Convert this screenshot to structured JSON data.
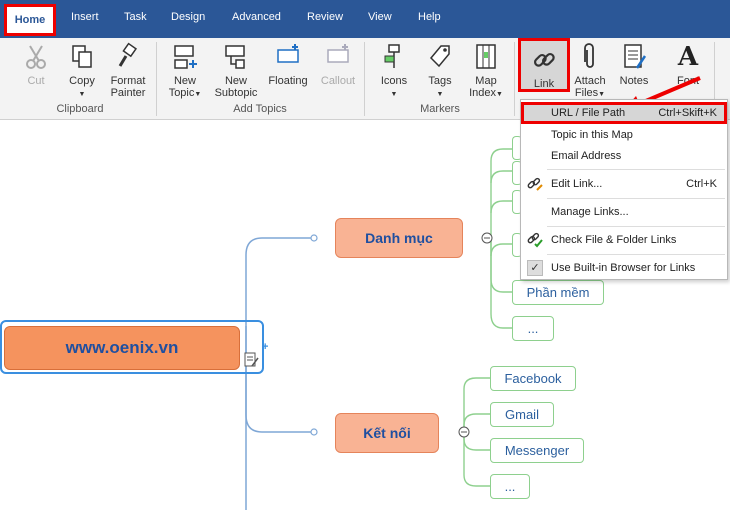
{
  "tabs": [
    "Home",
    "Insert",
    "Task",
    "Design",
    "Advanced",
    "Review",
    "View",
    "Help"
  ],
  "ribbon": {
    "cut": "Cut",
    "copy": "Copy",
    "format_painter_1": "Format",
    "format_painter_2": "Painter",
    "new_topic_1": "New",
    "new_topic_2": "Topic",
    "new_subtopic_1": "New",
    "new_subtopic_2": "Subtopic",
    "floating": "Floating",
    "callout": "Callout",
    "icons": "Icons",
    "tags": "Tags",
    "map_index_1": "Map",
    "map_index_2": "Index",
    "link": "Link",
    "attach_1": "Attach",
    "attach_2": "Files",
    "notes": "Notes",
    "font": "Font",
    "group_clipboard": "Clipboard",
    "group_add_topics": "Add Topics",
    "group_markers": "Markers"
  },
  "menu": {
    "url": "URL / File Path",
    "url_shortcut": "Ctrl+Skift+K",
    "topic": "Topic in this Map",
    "email": "Email Address",
    "edit": "Edit Link...",
    "edit_shortcut": "Ctrl+K",
    "manage": "Manage Links...",
    "check": "Check File & Folder Links",
    "browser": "Use Built-in Browser for Links"
  },
  "map": {
    "central": "www.oenix.vn",
    "topic1": "Danh mục",
    "topic1_subs": [
      "Phần mềm",
      "..."
    ],
    "topic2": "Kết nối",
    "topic2_subs": [
      "Facebook",
      "Gmail",
      "Messenger",
      "..."
    ]
  },
  "colors": {
    "tabbar": "#2b5797",
    "highlight": "#e00000",
    "central": "#f5935e",
    "main_topic": "#f9b394",
    "branch_line": "#7fa7d6",
    "subtopic_border": "#8ed08e"
  }
}
